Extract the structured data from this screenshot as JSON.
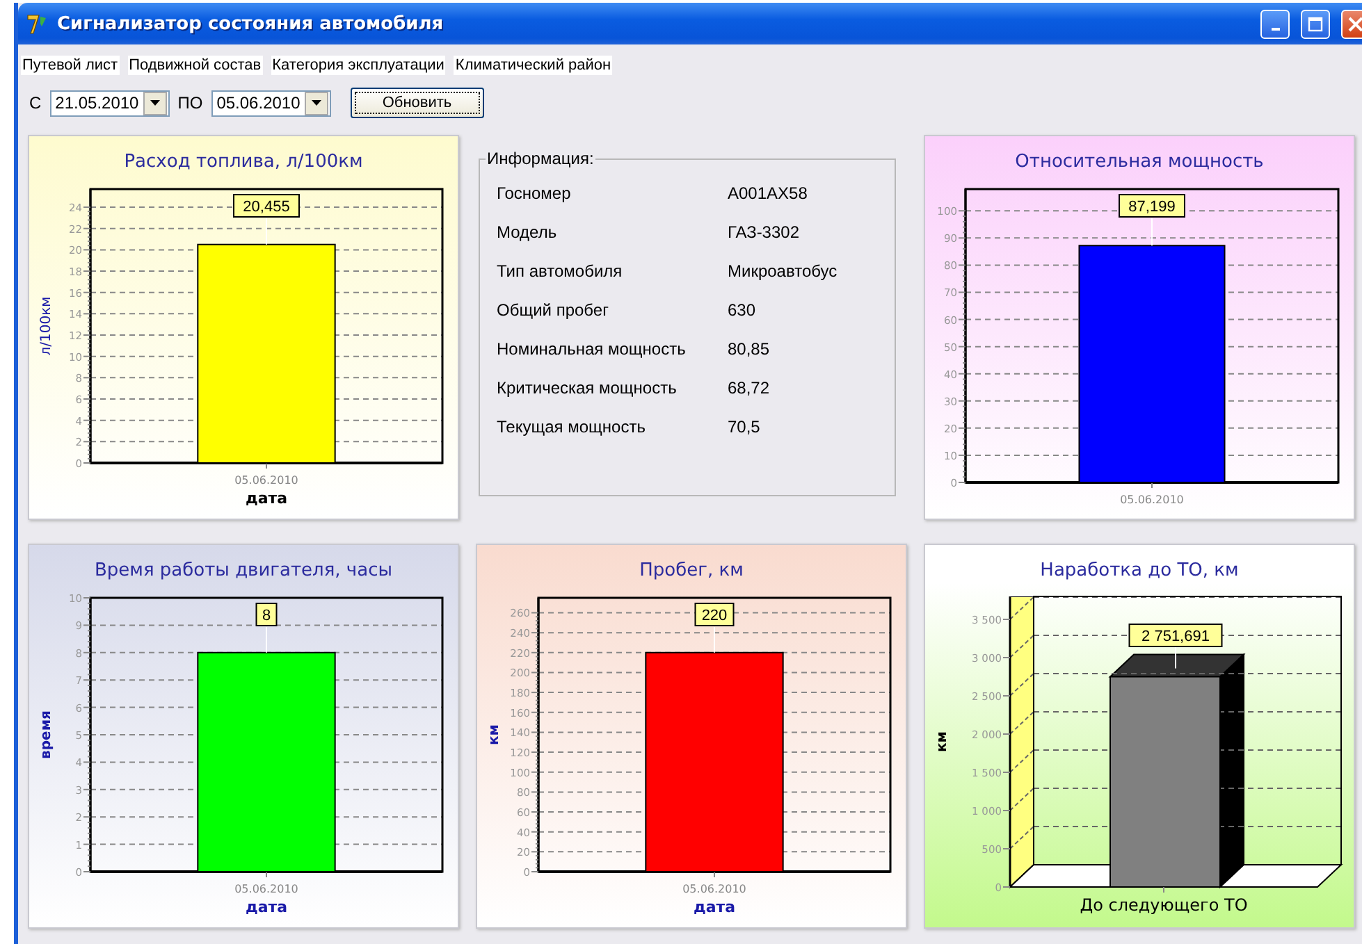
{
  "window": {
    "title": "Сигнализатор состояния автомобиля"
  },
  "menu": [
    {
      "label": "Путевой лист"
    },
    {
      "label": "Подвижной состав"
    },
    {
      "label": "Категория эксплуатации"
    },
    {
      "label": "Климатический район"
    }
  ],
  "filter": {
    "from_label": "С",
    "from_date": "21.05.2010",
    "to_label": "ПО",
    "to_date": "05.06.2010",
    "button": "Обновить"
  },
  "panels": [
    {
      "kind": "chart",
      "chart_data": {
        "type": "bar",
        "title": "Расход топлива, л/100км",
        "xlabel": "дата",
        "ylabel": "л/100км",
        "categories": [
          "05.06.2010"
        ],
        "series": [
          {
            "color": "#ffff00",
            "values": [
              20.5
            ]
          }
        ],
        "grid": true,
        "ylim": [
          0,
          25.7
        ],
        "yticks": [
          0,
          2,
          4,
          6,
          8,
          10,
          12,
          14,
          16,
          18,
          20,
          22,
          24
        ],
        "value_labels": [
          "20,455"
        ]
      }
    },
    {
      "kind": "info",
      "title": "Информация:",
      "rows": [
        {
          "label": "Госномер",
          "value": "А001АХ58"
        },
        {
          "label": "Модель",
          "value": "ГАЗ-3302"
        },
        {
          "label": "Тип автомобиля",
          "value": "Микроавтобус"
        },
        {
          "label": "Общий пробег",
          "value": "630"
        },
        {
          "label": "Номинальная мощность",
          "value": "80,85"
        },
        {
          "label": "Критическая мощность",
          "value": "68,72"
        },
        {
          "label": "Текущая мощность",
          "value": "70,5"
        }
      ]
    },
    {
      "kind": "chart",
      "chart_data": {
        "type": "bar",
        "title": "Относительная мощность",
        "categories": [
          "05.06.2010"
        ],
        "series": [
          {
            "color": "#0000ff",
            "values": [
              87.2
            ]
          }
        ],
        "grid": true,
        "ylim": [
          0,
          108
        ],
        "yticks": [
          0,
          10,
          20,
          30,
          40,
          50,
          60,
          70,
          80,
          90,
          100
        ],
        "value_labels": [
          "87,199"
        ]
      }
    },
    {
      "kind": "chart",
      "chart_data": {
        "type": "bar",
        "title": "Время работы двигателя, часы",
        "xlabel": "дата",
        "ylabel": "время",
        "categories": [
          "05.06.2010"
        ],
        "series": [
          {
            "color": "#00ff00",
            "values": [
              8
            ]
          }
        ],
        "grid": true,
        "ylim": [
          0,
          10
        ],
        "yticks": [
          0,
          1,
          2,
          3,
          4,
          5,
          6,
          7,
          8,
          9,
          10
        ],
        "value_labels": [
          "8"
        ]
      }
    },
    {
      "kind": "chart",
      "chart_data": {
        "type": "bar",
        "title": "Пробег, км",
        "xlabel": "дата",
        "ylabel": "км",
        "categories": [
          "05.06.2010"
        ],
        "series": [
          {
            "color": "#ff0000",
            "values": [
              220
            ]
          }
        ],
        "grid": true,
        "ylim": [
          0,
          275
        ],
        "yticks": [
          0,
          20,
          40,
          60,
          80,
          100,
          120,
          140,
          160,
          180,
          200,
          220,
          240,
          260
        ],
        "value_labels": [
          "220"
        ]
      }
    },
    {
      "kind": "chart3d",
      "chart_data": {
        "type": "bar",
        "title": "Наработка до ТО, км",
        "ylabel": "км",
        "categories": [
          "До следующего ТО"
        ],
        "series": [
          {
            "color": "#808080",
            "values": [
              2750
            ]
          }
        ],
        "grid": true,
        "ylim": [
          0,
          3800
        ],
        "yticks": [
          0,
          {
            "value": 500,
            "label": "500"
          },
          {
            "value": 1000,
            "label": "1 000"
          },
          {
            "value": 1500,
            "label": "1 500"
          },
          {
            "value": 2000,
            "label": "2 000"
          },
          {
            "value": 2500,
            "label": "2 500"
          },
          {
            "value": 3000,
            "label": "3 000"
          },
          {
            "value": 3500,
            "label": "3 500"
          }
        ],
        "value_labels": [
          "2 751,691"
        ]
      }
    }
  ]
}
